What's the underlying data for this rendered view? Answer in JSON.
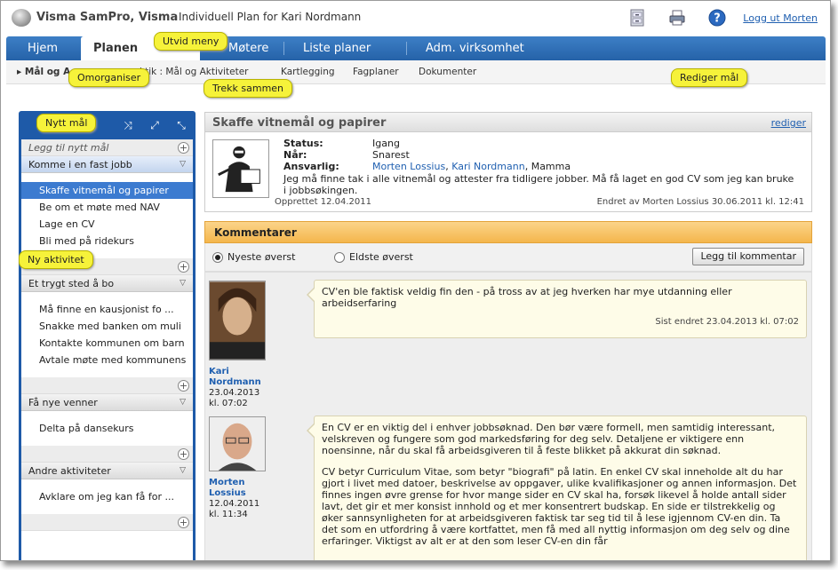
{
  "app": {
    "brand": "Visma SamPro, Visma",
    "page_title": "Individuell Plan for Kari Nordmann",
    "logout": "Logg ut Morten"
  },
  "nav": {
    "tabs": [
      "Hjem",
      "Planen",
      "Møtere",
      "Liste planer",
      "Adm. virksomhet"
    ],
    "active": 1
  },
  "subnav": [
    "▸ Mål og A",
    "ktik : Mål og Aktiviteter",
    "Kartlegging",
    "Fagplaner",
    "Dokumenter"
  ],
  "callouts": {
    "utvid": "Utvid meny",
    "omorganiser": "Omorganiser",
    "trekk": "Trekk sammen",
    "nytt": "Nytt mål",
    "rediger": "Rediger mål",
    "aktivitet": "Ny aktivitet"
  },
  "left": {
    "add_goal": "Legg til nytt mål",
    "groups": [
      {
        "title": "Komme i en fast jobb",
        "items": [
          "Skaffe vitnemål og papirer",
          "Be om et møte med NAV",
          "Lage en CV",
          "Bli med på ridekurs"
        ]
      },
      {
        "title": "Et trygt sted å bo",
        "items": [
          "Må finne en kausjonist fo ...",
          "Snakke med banken om muli",
          "Kontakte kommunen om barn",
          "Avtale møte med kommunens"
        ]
      },
      {
        "title": "Få nye venner",
        "items": [
          "Delta på dansekurs"
        ]
      },
      {
        "title": "Andre aktiviteter",
        "items": [
          "Avklare om jeg kan få for ..."
        ]
      }
    ]
  },
  "detail": {
    "title": "Skaffe vitnemål og papirer",
    "edit": "rediger",
    "status_label": "Status:",
    "status": "Igang",
    "when_label": "Når:",
    "when": "Snarest",
    "resp_label": "Ansvarlig:",
    "resp1": "Morten Lossius",
    "resp2": "Kari Nordmann",
    "resp3": "Mamma",
    "desc": "Jeg må finne tak i alle vitnemål og attester fra tidligere jobber.  Må få laget en god CV som jeg kan bruke i jobbsøkingen.",
    "created": "Opprettet 12.04.2011",
    "changed": "Endret av Morten Lossius 30.06.2011 kl. 12:41"
  },
  "comments": {
    "title": "Kommentarer",
    "newest": "Nyeste øverst",
    "oldest": "Eldste øverst",
    "add": "Legg til kommentar",
    "list": [
      {
        "name1": "Kari",
        "name2": "Nordmann",
        "date": "23.04.2013",
        "time": "kl. 07:02",
        "text": "CV'en ble faktisk veldig fin den - på tross av at jeg hverken har mye utdanning eller arbeidserfaring",
        "stamp": "Sist endret 23.04.2013 kl. 07:02"
      },
      {
        "name1": "Morten",
        "name2": "Lossius",
        "date": "12.04.2011",
        "time": "kl. 11:34",
        "p1": "En CV er en viktig del i enhver jobbsøknad. Den bør være formell, men samtidig interessant, velskreven og fungere som god markedsføring for deg selv. Detaljene er viktigere enn noensinne, når du skal få arbeidsgiveren til å feste blikket på akkurat din søknad.",
        "p2": "CV betyr Curriculum Vitae, som betyr \"biografi\" på latin. En enkel CV skal inneholde alt du har gjort i livet med datoer, beskrivelse av oppgaver, ulike kvalifikasjoner og annen informasjon. Det finnes ingen øvre grense for hvor mange sider en CV skal ha, forsøk likevel å holde antall sider lavt, det gir et mer konsist innhold og et mer konsentrert budskap. En side er tilstrekkelig og øker sannsynligheten for at arbeidsgiveren faktisk tar seg tid til å lese igjennom CV-en din. Ta det som en utfordring å være kortfattet, men få med all nyttig informasjon om deg selv og dine erfaringer. Viktigst av alt er at den som leser CV-en din får"
      }
    ]
  }
}
